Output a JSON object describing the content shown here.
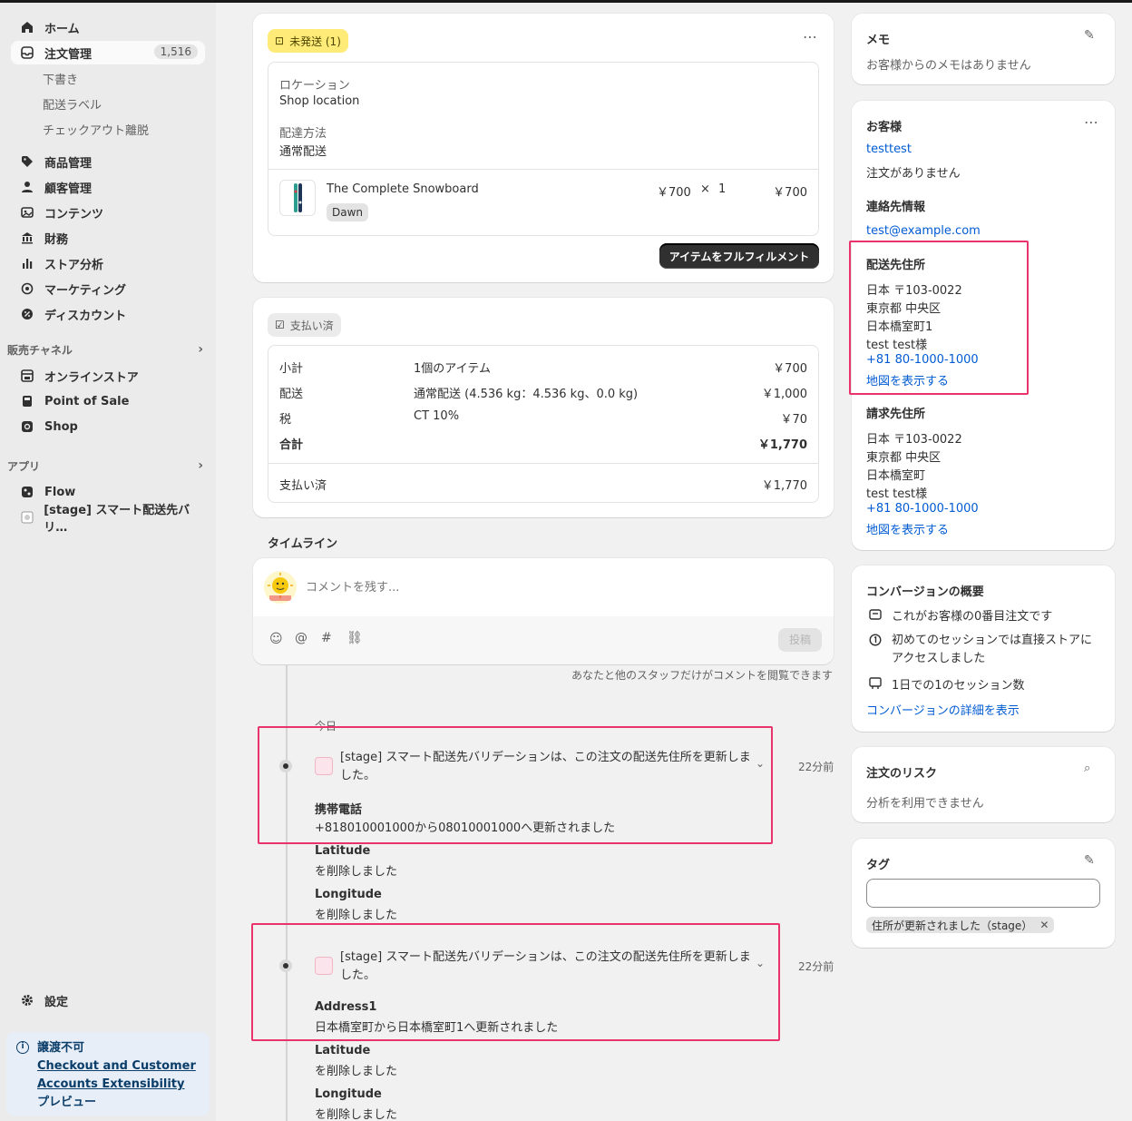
{
  "sidebar": {
    "home": "ホーム",
    "orders": "注文管理",
    "orders_count": "1,516",
    "orders_sub": [
      "下書き",
      "配送ラベル",
      "チェックアウト離脱"
    ],
    "products": "商品管理",
    "customers": "顧客管理",
    "content": "コンテンツ",
    "finance": "財務",
    "analytics": "ストア分析",
    "marketing": "マーケティング",
    "discounts": "ディスカウント",
    "channels_head": "販売チャネル",
    "online_store": "オンラインストア",
    "pos": "Point of Sale",
    "shop": "Shop",
    "apps_head": "アプリ",
    "flow": "Flow",
    "stage_app": "[stage] スマート配送先バリ…",
    "settings": "設定",
    "notice_title": "譲渡不可",
    "notice_link": "Checkout and Customer Accounts Extensibility",
    "notice_suffix": "プレビュー"
  },
  "fulfillment": {
    "badge": "未発送 (1)",
    "location_label": "ロケーション",
    "location_value": "Shop location",
    "method_label": "配達方法",
    "method_value": "通常配送",
    "product_name": "The Complete Snowboard",
    "variant": "Dawn",
    "unit_price": "￥700",
    "times": "×",
    "qty": "1",
    "line_total": "￥700",
    "fulfill_button": "アイテムをフルフィルメント"
  },
  "payment": {
    "badge": "支払い済",
    "rows": [
      {
        "label": "小計",
        "desc": "1個のアイテム",
        "amount": "￥700"
      },
      {
        "label": "配送",
        "desc": "通常配送 (4.536 kg：4.536 kg、0.0 kg)",
        "amount": "￥1,000"
      },
      {
        "label": "税",
        "desc": "CT 10%",
        "amount": "￥70"
      },
      {
        "label": "合計",
        "desc": "",
        "amount": "￥1,770"
      }
    ],
    "paid_label": "支払い済",
    "paid_amount": "￥1,770"
  },
  "timeline": {
    "title": "タイムライン",
    "comment_placeholder": "コメントを残す...",
    "post_button": "投稿",
    "staff_note": "あなたと他のスタッフだけがコメントを閲覧できます",
    "today": "今日",
    "events": [
      {
        "message": "[stage] スマート配送先バリデーションは、この注文の配送先住所を更新しました。",
        "time": "22分前",
        "changes": [
          {
            "field": "携帯電話",
            "detail": "+818010001000から08010001000へ更新されました"
          },
          {
            "field": "Latitude",
            "detail": "を削除しました"
          },
          {
            "field": "Longitude",
            "detail": "を削除しました"
          }
        ]
      },
      {
        "message": "[stage] スマート配送先バリデーションは、この注文の配送先住所を更新しました。",
        "time": "22分前",
        "changes": [
          {
            "field": "Address1",
            "detail": "日本橋室町から日本橋室町1へ更新されました"
          },
          {
            "field": "Latitude",
            "detail": "を削除しました"
          },
          {
            "field": "Longitude",
            "detail": "を削除しました"
          }
        ]
      }
    ]
  },
  "notes": {
    "title": "メモ",
    "empty": "お客様からのメモはありません"
  },
  "customer": {
    "title": "お客様",
    "name": "testtest",
    "orders": "注文がありません",
    "contact_title": "連絡先情報",
    "email": "test@example.com",
    "shipping_title": "配送先住所",
    "shipping_lines": [
      "日本 〒103-0022",
      "東京都 中央区",
      "日本橋室町1",
      "test test様"
    ],
    "shipping_phone": "+81 80-1000-1000",
    "shipping_map": "地図を表示する",
    "billing_title": "請求先住所",
    "billing_lines": [
      "日本 〒103-0022",
      "東京都 中央区",
      "日本橋室町",
      "test test様"
    ],
    "billing_phone": "+81 80-1000-1000",
    "billing_map": "地図を表示する"
  },
  "conversion": {
    "title": "コンバージョンの概要",
    "items": [
      "これがお客様の0番目注文です",
      "初めてのセッションでは直接ストアにアクセスしました",
      "1日での1のセッション数"
    ],
    "link": "コンバージョンの詳細を表示"
  },
  "risk": {
    "title": "注文のリスク",
    "text": "分析を利用できません"
  },
  "tags": {
    "title": "タグ",
    "input_value": "",
    "chip": "住所が更新されました（stage）"
  },
  "colors": {
    "highlight": "#e8336d",
    "link": "#005bd3",
    "unfulfilled": "#ffeb78"
  }
}
